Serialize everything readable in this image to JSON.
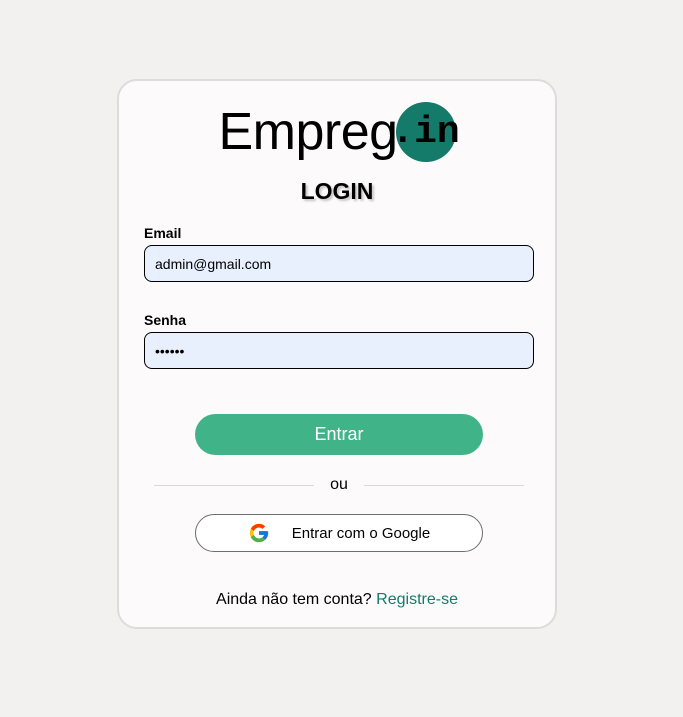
{
  "logo": {
    "text": "Empreg",
    "badge": ".in",
    "badge_color": "#147a6a"
  },
  "form": {
    "title": "LOGIN",
    "email_label": "Email",
    "email_value": "admin@gmail.com",
    "password_label": "Senha",
    "password_value": "123456",
    "submit_label": "Entrar",
    "divider_text": "ou",
    "google_label": "Entrar com o Google",
    "google_icon": "google-g-icon"
  },
  "footer": {
    "prompt": "Ainda não tem conta?",
    "register_link": "Registre-se"
  },
  "colors": {
    "primary": "#41b389",
    "accent": "#147a6a",
    "input_bg": "#e8f0fe"
  }
}
